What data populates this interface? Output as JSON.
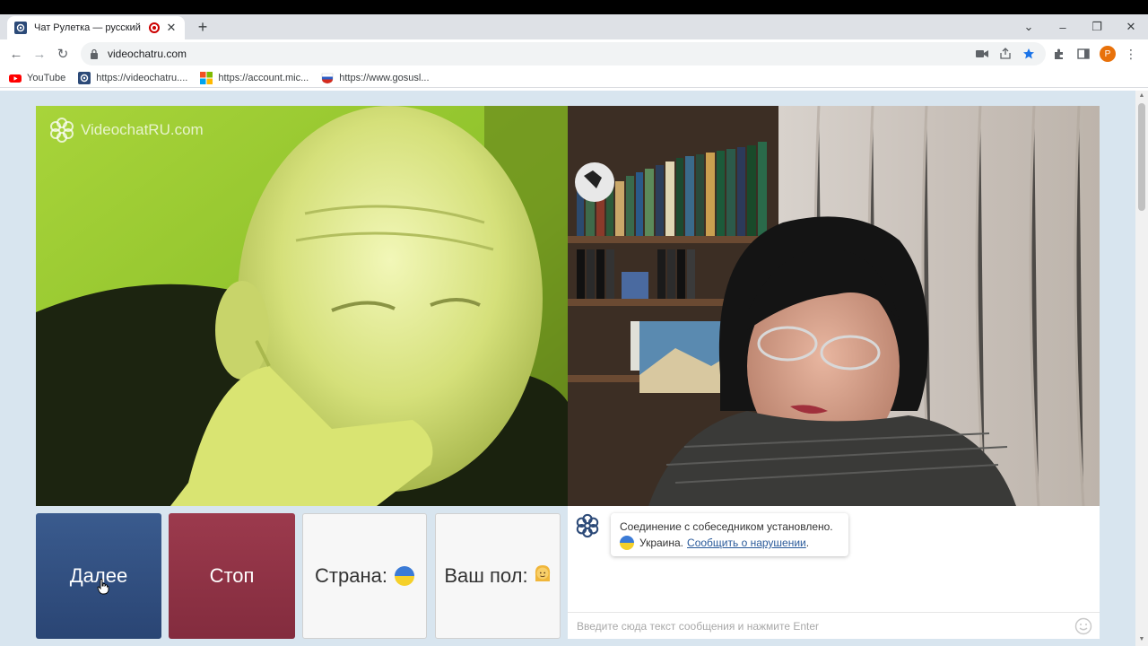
{
  "browser": {
    "tab_title": "Чат Рулетка — русский вид",
    "new_tab_label": "+",
    "url": "videochatru.com",
    "profile_initial": "P",
    "bookmarks": [
      {
        "label": "YouTube"
      },
      {
        "label": "https://videochatru...."
      },
      {
        "label": "https://account.mic..."
      },
      {
        "label": "https://www.gosusl..."
      }
    ]
  },
  "page": {
    "watermark": "VideochatRU.com",
    "buttons": {
      "next": "Далее",
      "stop": "Стоп",
      "country": "Страна:",
      "gender": "Ваш пол:"
    },
    "gender_emoji": "👱‍♀️",
    "chat": {
      "status": "Соединение с собеседником установлено.",
      "country": "Украина.",
      "report_link": "Сообщить о нарушении",
      "period": ".",
      "input_placeholder": "Введите сюда текст сообщения и нажмите Enter"
    }
  },
  "colors": {
    "next_button": "#2f4f82",
    "stop_button": "#8e3346",
    "page_bg": "#d8e5ef",
    "profile": "#e8710a"
  }
}
